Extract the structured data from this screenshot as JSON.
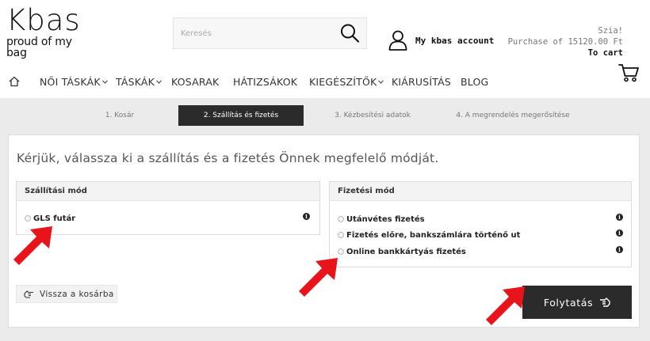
{
  "header": {
    "logo_word": "Kbas",
    "logo_tagline": "proud of my bag",
    "search_placeholder": "Keresés",
    "account_label": "My kbas account",
    "greeting": "Szia!",
    "purchase_text": "Purchase of 15120.00 Ft",
    "to_cart": "To cart"
  },
  "nav": {
    "items": [
      {
        "label": "NŐI TÁSKÁK",
        "has_dropdown": true
      },
      {
        "label": "TÁSKÁK",
        "has_dropdown": true
      },
      {
        "label": "KOSARAK",
        "has_dropdown": false
      },
      {
        "label": "HÁTIZSÁKOK",
        "has_dropdown": false
      },
      {
        "label": "KIEGÉSZÍTŐK",
        "has_dropdown": true
      },
      {
        "label": "KIÁRUSÍTÁS",
        "has_dropdown": false
      },
      {
        "label": "BLOG",
        "has_dropdown": false
      }
    ]
  },
  "steps": [
    {
      "label": "1. Kosár",
      "active": false
    },
    {
      "label": "2. Szállítás és fizetés",
      "active": true
    },
    {
      "label": "3. Kézbesítési adatok",
      "active": false
    },
    {
      "label": "4. A megrendelés megerősítése",
      "active": false
    }
  ],
  "main": {
    "title": "Kérjük, válassza ki a szállítás és a fizetés Önnek megfelelő módját.",
    "shipping": {
      "heading": "Szállítási mód",
      "options": [
        "GLS futár"
      ]
    },
    "payment": {
      "heading": "Fizetési mód",
      "options": [
        "Utánvétes fizetés",
        "Fizetés előre, bankszámlára történő ut",
        "Online bankkártyás fizetés"
      ]
    },
    "back_label": "Vissza a kosárba",
    "continue_label": "Folytatás"
  },
  "colors": {
    "dark_button": "#2b2b2b",
    "gray_background": "#ebebeb",
    "annotation_arrow": "#e8141b"
  },
  "icons": [
    "search-icon",
    "user-icon",
    "cart-icon",
    "home-icon",
    "chevron-down-icon",
    "info-icon",
    "hand-pointing-left-icon",
    "hand-pointing-right-icon"
  ]
}
